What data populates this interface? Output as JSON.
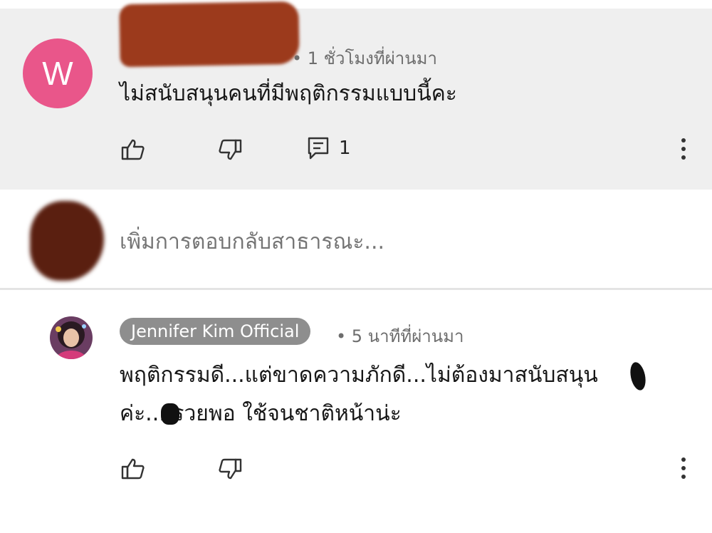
{
  "comment": {
    "avatar_letter": "W",
    "time": "• 1 ชั่วโมงที่ผ่านมา",
    "text": "ไม่สนับสนุนคนที่มีพฤติกรรมแบบนี้คะ",
    "reply_count": "1"
  },
  "reply_box": {
    "placeholder": "เพิ่มการตอบกลับสาธารณะ..."
  },
  "reply": {
    "author": "Jennifer Kim Official",
    "time": "• 5 นาทีที่ผ่านมา",
    "line1": "พฤติกรรมดี...แต่ขาดความภักดี...ไม่ต้องมาสนับสนุน",
    "line2": "ค่ะ... รวยพอ ใช้จนชาติหน้าน่ะ"
  },
  "icons": {
    "like": "thumbs-up-icon",
    "dislike": "thumbs-down-icon",
    "replies": "comment-icon",
    "more": "more-vertical-icon"
  },
  "colors": {
    "avatar_w": "#e9568a",
    "comment_background": "#efefef",
    "redaction": "#9c3a1c",
    "author_badge": "#8e8e8e"
  }
}
